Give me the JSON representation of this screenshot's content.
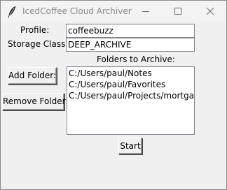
{
  "window": {
    "title": "IcedCoffee Cloud Archiver"
  },
  "titlebar_icons": {
    "app": "feather-icon",
    "minimize": "minimize-icon",
    "maximize": "maximize-icon",
    "close": "close-icon"
  },
  "form": {
    "profile_label": "Profile:",
    "profile_value": "coffeebuzz",
    "storage_class_label": "Storage Class:",
    "storage_class_value": "DEEP_ARCHIVE",
    "folders_label": "Folders to Archive:"
  },
  "buttons": {
    "add_folder": "Add Folder:",
    "remove_folder": "Remove Folder:",
    "start": "Start"
  },
  "folders": [
    "C:/Users/paul/Notes",
    "C:/Users/paul/Favorites",
    "C:/Users/paul/Projects/mortgagec"
  ],
  "colors": {
    "window_bg": "#f0f0f0",
    "title_text": "#8a8a8a"
  }
}
